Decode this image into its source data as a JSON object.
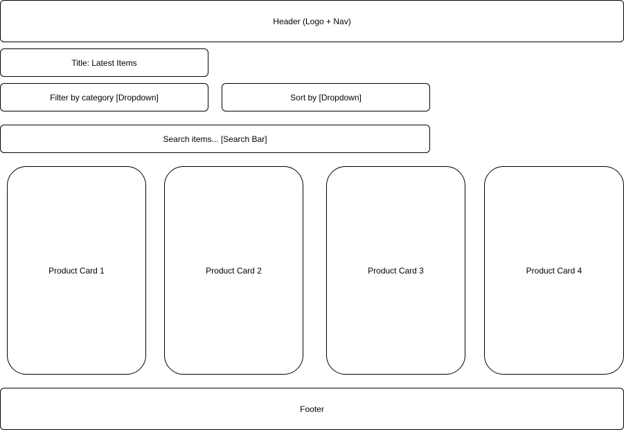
{
  "header": {
    "label": "Header (Logo + Nav)"
  },
  "title": {
    "label": "Title: Latest Items"
  },
  "filter": {
    "label": "Filter by category [Dropdown]"
  },
  "sort": {
    "label": "Sort by [Dropdown]"
  },
  "search": {
    "label": "Search items... [Search Bar]"
  },
  "products": [
    {
      "label": "Product Card 1"
    },
    {
      "label": "Product Card 2"
    },
    {
      "label": "Product Card 3"
    },
    {
      "label": "Product Card 4"
    }
  ],
  "footer": {
    "label": "Footer"
  },
  "colors": {
    "stroke": "#000000",
    "fill": "#ffffff"
  }
}
